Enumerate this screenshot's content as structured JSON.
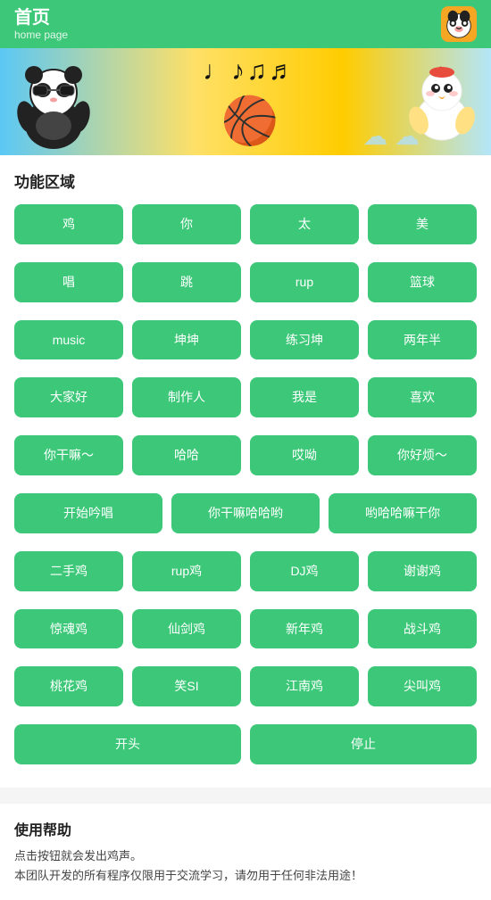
{
  "header": {
    "title": "首页",
    "subtitle": "home page"
  },
  "banner": {
    "music_notes": "♩ ♪ ♫ ♬",
    "panda_emoji": "🐼",
    "basketball_emoji": "🏀",
    "chicken_emoji": "🐔"
  },
  "function_area": {
    "title": "功能区域",
    "rows": [
      [
        "鸡",
        "你",
        "太",
        "美"
      ],
      [
        "唱",
        "跳",
        "rup",
        "篮球"
      ],
      [
        "music",
        "坤坤",
        "练习坤",
        "两年半"
      ],
      [
        "大家好",
        "制作人",
        "我是",
        "喜欢"
      ],
      [
        "你干嘛～",
        "哈哈",
        "哎呦",
        "你好烦～"
      ]
    ],
    "wide_rows": [
      [
        "开始吟唱",
        "你干嘛哈哈哟",
        "哟哈哈嘛干你"
      ]
    ],
    "rows2": [
      [
        "二手鸡",
        "rup鸡",
        "DJ鸡",
        "谢谢鸡"
      ],
      [
        "惊魂鸡",
        "仙剑鸡",
        "新年鸡",
        "战斗鸡"
      ],
      [
        "桃花鸡",
        "笑SI",
        "江南鸡",
        "尖叫鸡"
      ]
    ],
    "action_buttons": [
      "开头",
      "停止"
    ]
  },
  "help": {
    "title": "使用帮助",
    "lines": [
      "点击按钮就会发出鸡声。",
      "本团队开发的所有程序仅限用于交流学习，请勿用于任何非法用途！"
    ]
  }
}
